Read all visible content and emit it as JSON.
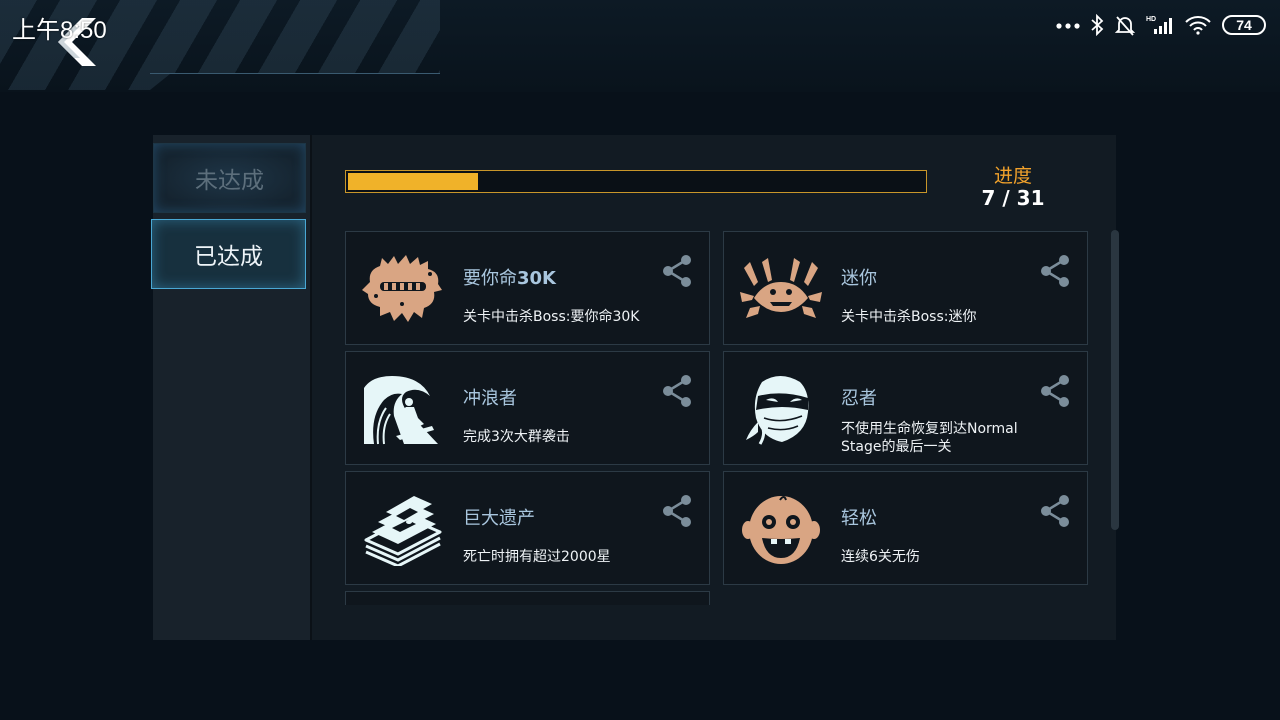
{
  "status_bar": {
    "time": "上午8:50",
    "battery": "74",
    "icons": [
      "more-dots-icon",
      "bluetooth-icon",
      "mute-bell-icon",
      "hd-signal-icon",
      "wifi-icon",
      "battery-icon"
    ]
  },
  "tabs": {
    "unachieved": "未达成",
    "achieved": "已达成",
    "selected": "achieved"
  },
  "progress": {
    "label": "进度",
    "value_text": "7 / 31",
    "current": 7,
    "total": 31
  },
  "colors": {
    "progress_fill": "#f0b229",
    "progress_label": "#f2a22b",
    "card_title": "#a9c6de",
    "icon_tan": "#d9a583",
    "icon_cyan": "#e6f6f8"
  },
  "achievements": [
    {
      "icon": "spiky-boss-icon",
      "title_prefix": "要你命",
      "title_bold": "30K",
      "desc": "关卡中击杀Boss:要你命30K"
    },
    {
      "icon": "crab-boss-icon",
      "title_prefix": "迷你",
      "title_bold": "",
      "desc": "关卡中击杀Boss:迷你"
    },
    {
      "icon": "surfer-wave-icon",
      "title_prefix": "冲浪者",
      "title_bold": "",
      "desc": "完成3次大群袭击"
    },
    {
      "icon": "ninja-icon",
      "title_prefix": "忍者",
      "title_bold": "",
      "desc": "不使用生命恢复到达Normal Stage的最后一关"
    },
    {
      "icon": "money-stack-icon",
      "title_prefix": "巨大遗产",
      "title_bold": "",
      "desc": "死亡时拥有超过2000星"
    },
    {
      "icon": "baby-face-icon",
      "title_prefix": "轻松",
      "title_bold": "",
      "desc": "连续6关无伤"
    }
  ]
}
